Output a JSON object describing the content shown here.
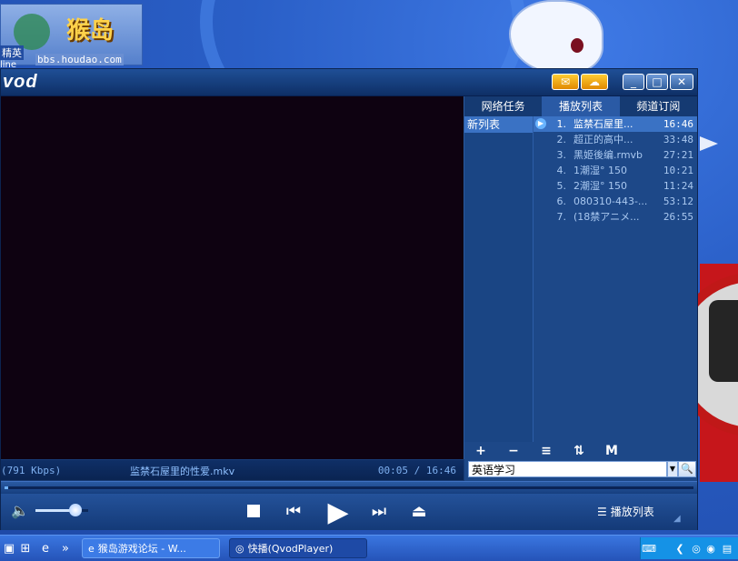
{
  "desktop": {
    "logo_text": "猴岛",
    "logo_url": "bbs.houdao.com",
    "icon_label": "精英",
    "icon_sub": "line"
  },
  "player": {
    "brand": "vod",
    "video_area_color": "#0e0211",
    "status": {
      "bitrate": "(791 Kbps)",
      "filename": "监禁石屋里的性爱.mkv",
      "time": "00:05 / 16:46"
    },
    "seek_progress": 0.005,
    "volume_level": 0.75,
    "playlist_toggle_label": "播放列表",
    "panel": {
      "tabs": [
        "网络任务",
        "播放列表",
        "频道订阅"
      ],
      "active_tab": 1,
      "lists": [
        "新列表"
      ],
      "entries": [
        {
          "idx": "1.",
          "title": "监禁石屋里...",
          "dur": "16:46",
          "selected": true
        },
        {
          "idx": "2.",
          "title": "超正的高中...",
          "dur": "33:48"
        },
        {
          "idx": "3.",
          "title": "黑姬後编.rmvb",
          "dur": "27:21"
        },
        {
          "idx": "4.",
          "title": "1潮湿° 150",
          "dur": "10:21"
        },
        {
          "idx": "5.",
          "title": "2潮湿° 150",
          "dur": "11:24"
        },
        {
          "idx": "6.",
          "title": "080310-443-...",
          "dur": "53:12"
        },
        {
          "idx": "7.",
          "title": "(18禁アニメ...",
          "dur": "26:55"
        }
      ],
      "tools": [
        "+",
        "−",
        "≡",
        "⇅",
        "M"
      ],
      "search_value": "英语学习"
    }
  },
  "taskbar": {
    "task1_label": "猴岛游戏论坛 - W...",
    "task2_label": "快播(QvodPlayer)"
  },
  "colors": {
    "accent": "#3a72c4",
    "window_bg": "#173a74",
    "taskbar": "#2553b8"
  }
}
